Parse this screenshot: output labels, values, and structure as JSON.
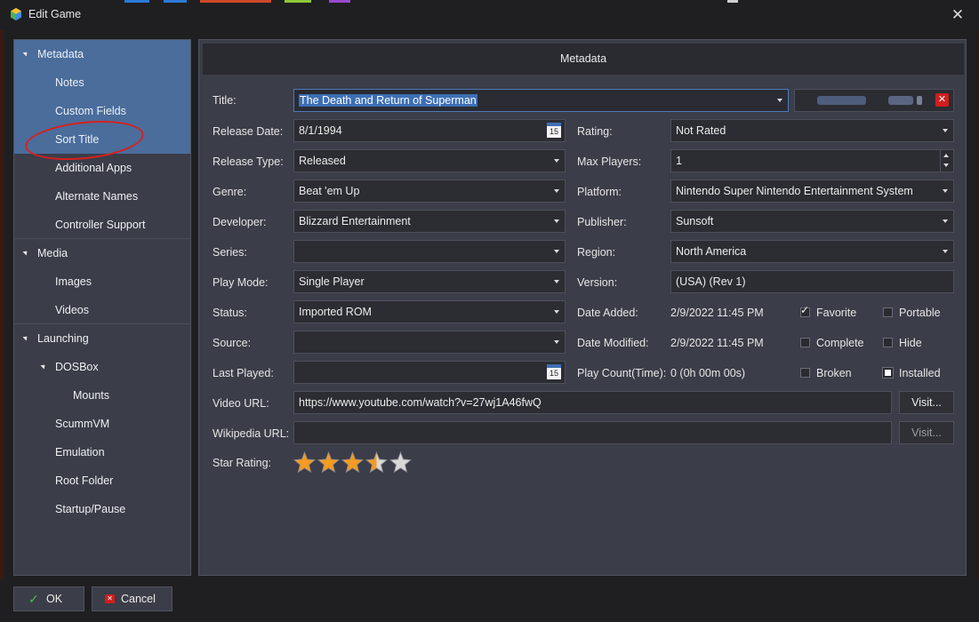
{
  "window": {
    "title": "Edit Game",
    "close_glyph": "✕"
  },
  "colors": {
    "accent": "#4a6d9c",
    "annotation": "#d8201c",
    "star_fill": "#f59b1f"
  },
  "sidebar": {
    "items": [
      {
        "label": "Metadata",
        "indent": 0,
        "expander": true,
        "selected": true
      },
      {
        "label": "Notes",
        "indent": 1,
        "selected": true
      },
      {
        "label": "Custom Fields",
        "indent": 1,
        "selected": true
      },
      {
        "label": "Sort Title",
        "indent": 1,
        "selected": true
      },
      {
        "label": "Additional Apps",
        "indent": 1
      },
      {
        "label": "Alternate Names",
        "indent": 1
      },
      {
        "label": "Controller Support",
        "indent": 1
      },
      {
        "label": "Media",
        "indent": 0,
        "expander": true
      },
      {
        "label": "Images",
        "indent": 1
      },
      {
        "label": "Videos",
        "indent": 1
      },
      {
        "label": "Launching",
        "indent": 0,
        "expander": true
      },
      {
        "label": "DOSBox",
        "indent": 1,
        "expander": true
      },
      {
        "label": "Mounts",
        "indent": 2
      },
      {
        "label": "ScummVM",
        "indent": 1
      },
      {
        "label": "Emulation",
        "indent": 1
      },
      {
        "label": "Root Folder",
        "indent": 1
      },
      {
        "label": "Startup/Pause",
        "indent": 1
      }
    ]
  },
  "panel": {
    "header": "Metadata",
    "title": {
      "label": "Title:",
      "value": "The Death and Return of Superman"
    },
    "release_date": {
      "label": "Release Date:",
      "value": "8/1/1994",
      "cal_day": "15"
    },
    "rating": {
      "label": "Rating:",
      "value": "Not Rated"
    },
    "release_type": {
      "label": "Release Type:",
      "value": "Released"
    },
    "max_players": {
      "label": "Max Players:",
      "value": "1"
    },
    "genre": {
      "label": "Genre:",
      "value": "Beat 'em Up"
    },
    "platform": {
      "label": "Platform:",
      "value": "Nintendo Super Nintendo Entertainment System"
    },
    "developer": {
      "label": "Developer:",
      "value": "Blizzard Entertainment"
    },
    "publisher": {
      "label": "Publisher:",
      "value": "Sunsoft"
    },
    "series": {
      "label": "Series:",
      "value": ""
    },
    "region": {
      "label": "Region:",
      "value": "North America"
    },
    "play_mode": {
      "label": "Play Mode:",
      "value": "Single Player"
    },
    "version": {
      "label": "Version:",
      "value": "(USA) (Rev 1)"
    },
    "status": {
      "label": "Status:",
      "value": "Imported ROM"
    },
    "date_added": {
      "label": "Date Added:",
      "value": "2/9/2022 11:45 PM"
    },
    "source": {
      "label": "Source:",
      "value": ""
    },
    "date_modified": {
      "label": "Date Modified:",
      "value": "2/9/2022 11:45 PM"
    },
    "last_played": {
      "label": "Last Played:",
      "value": "",
      "cal_day": "15"
    },
    "play_count": {
      "label": "Play Count(Time):",
      "value": "0 (0h 00m 00s)"
    },
    "video_url": {
      "label": "Video URL:",
      "value": "https://www.youtube.com/watch?v=27wj1A46fwQ",
      "button": "Visit..."
    },
    "wikipedia_url": {
      "label": "Wikipedia URL:",
      "value": "",
      "button": "Visit..."
    },
    "star_rating": {
      "label": "Star Rating:",
      "value": 3.5,
      "max": 5
    },
    "checkboxes": {
      "favorite": {
        "label": "Favorite",
        "checked": true
      },
      "portable": {
        "label": "Portable",
        "checked": false
      },
      "complete": {
        "label": "Complete",
        "checked": false
      },
      "hide": {
        "label": "Hide",
        "checked": false
      },
      "broken": {
        "label": "Broken",
        "checked": false
      },
      "installed": {
        "label": "Installed",
        "checked": "indeterminate"
      }
    }
  },
  "footer": {
    "ok": "OK",
    "cancel": "Cancel"
  }
}
